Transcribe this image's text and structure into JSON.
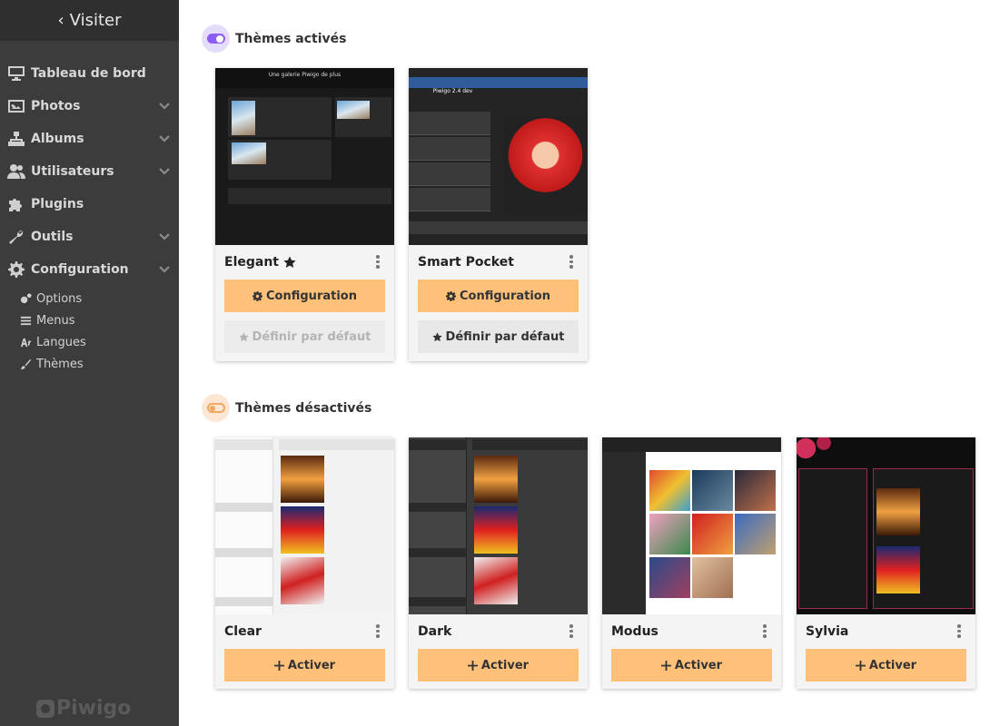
{
  "sidebar": {
    "visit_label": "Visiter",
    "items": [
      {
        "label": "Tableau de bord",
        "icon": "monitor-icon",
        "has_arrow": false
      },
      {
        "label": "Photos",
        "icon": "image-icon",
        "has_arrow": true
      },
      {
        "label": "Albums",
        "icon": "sitemap-icon",
        "has_arrow": true
      },
      {
        "label": "Utilisateurs",
        "icon": "users-icon",
        "has_arrow": true
      },
      {
        "label": "Plugins",
        "icon": "puzzle-icon",
        "has_arrow": false
      },
      {
        "label": "Outils",
        "icon": "wrench-icon",
        "has_arrow": true
      },
      {
        "label": "Configuration",
        "icon": "gear-icon",
        "has_arrow": true
      }
    ],
    "sub_items": [
      {
        "label": "Options",
        "icon": "gears-icon"
      },
      {
        "label": "Menus",
        "icon": "bars-icon"
      },
      {
        "label": "Langues",
        "icon": "language-icon"
      },
      {
        "label": "Thèmes",
        "icon": "brush-icon"
      }
    ],
    "logo_text": "Piwigo"
  },
  "active_section": {
    "title": "Thèmes activés",
    "toggle_color": "#8b5cf6",
    "toggle_bg": "#e5dcfb",
    "themes": [
      {
        "name": "Elegant",
        "is_default": true,
        "config_label": "Configuration",
        "default_label": "Définir par défaut",
        "thumb_title": "Une galerie Piwigo de plus"
      },
      {
        "name": "Smart Pocket",
        "is_default": false,
        "config_label": "Configuration",
        "default_label": "Définir par défaut",
        "thumb_title": "Piwigo 2.4 dev"
      }
    ]
  },
  "inactive_section": {
    "title": "Thèmes désactivés",
    "toggle_color": "#f0a860",
    "toggle_bg": "#fde7d4",
    "themes": [
      {
        "name": "Clear",
        "activate_label": "Activer"
      },
      {
        "name": "Dark",
        "activate_label": "Activer"
      },
      {
        "name": "Modus",
        "activate_label": "Activer"
      },
      {
        "name": "Sylvia",
        "activate_label": "Activer"
      }
    ]
  },
  "colors": {
    "accent_button": "#ffc17a",
    "sidebar_bg": "#3c3c3c"
  }
}
